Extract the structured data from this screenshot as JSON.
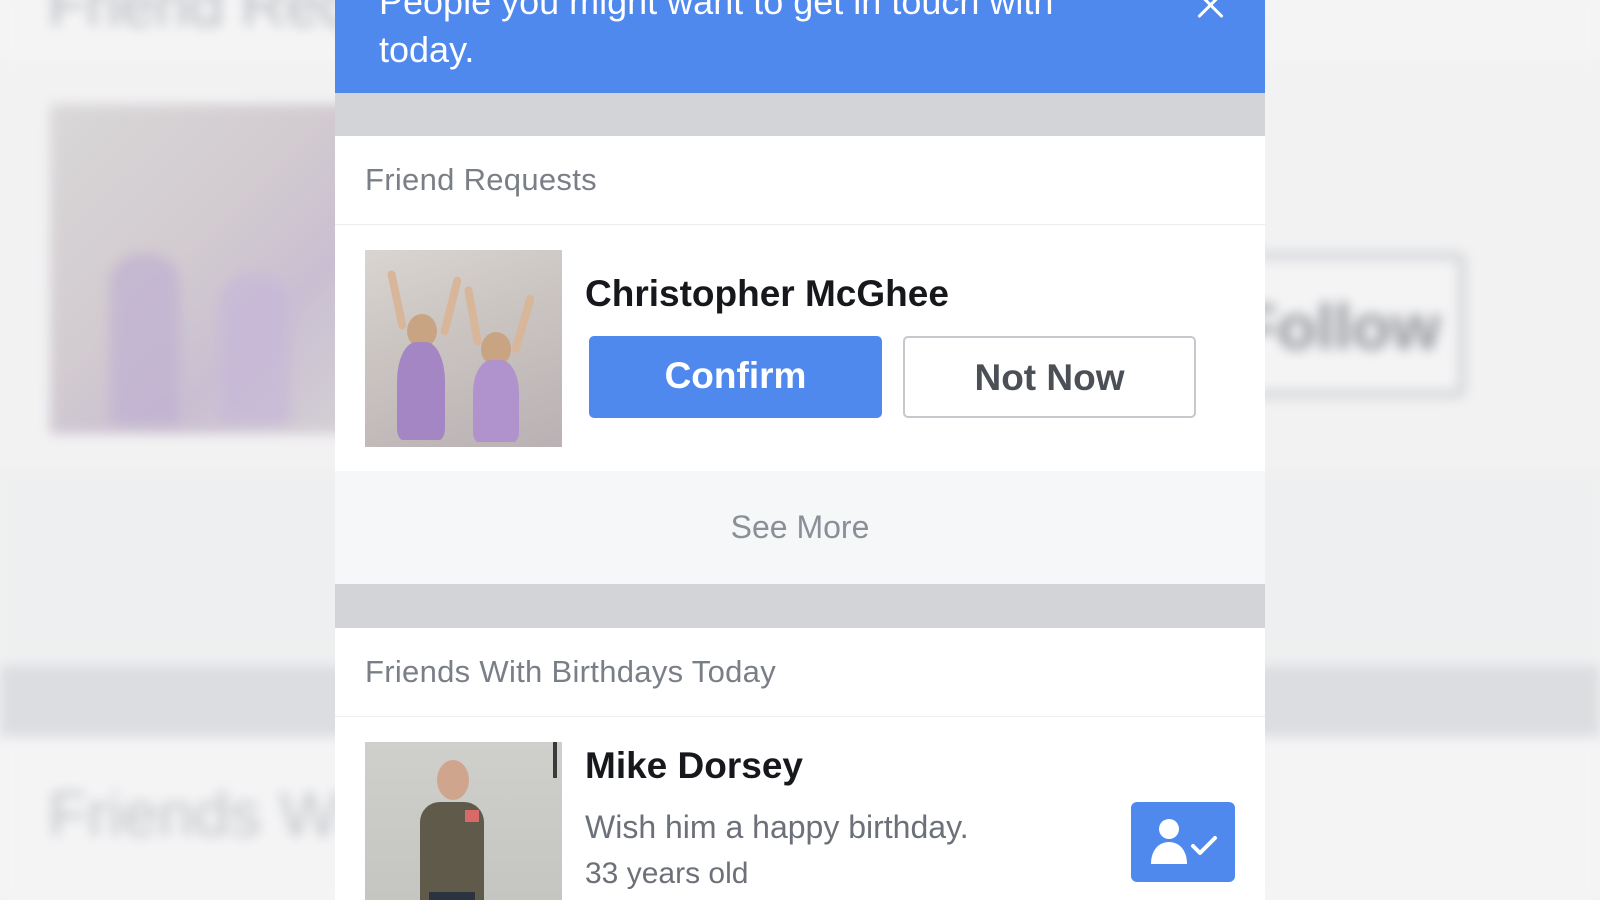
{
  "banner": {
    "text": "People you might want to get in touch with today.",
    "close_icon": "close-icon"
  },
  "friend_requests": {
    "heading": "Friend Requests",
    "request": {
      "name": "Christopher McGhee",
      "confirm_label": "Confirm",
      "not_now_label": "Not Now"
    },
    "see_more_label": "See More"
  },
  "birthdays": {
    "heading": "Friends With Birthdays Today",
    "person": {
      "name": "Mike Dorsey",
      "message": "Wish him a happy birthday.",
      "age": "33 years old",
      "action_icon": "friend-check-icon"
    }
  },
  "backdrop": {
    "title": "Friend Requests",
    "button_label": "Follow",
    "section": "Friends With Birthdays Today"
  },
  "colors": {
    "accent": "#4f89ee",
    "section_gap": "#d2d4d8",
    "heading_text": "#7a7f87"
  }
}
